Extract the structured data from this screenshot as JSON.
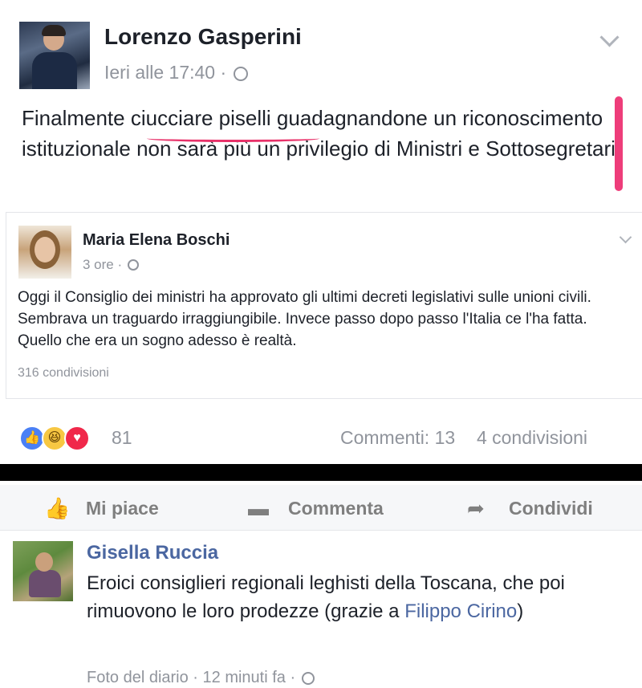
{
  "post": {
    "author": "Lorenzo Gasperini",
    "time": "Ieri alle 17:40 ·",
    "text": "Finalmente ciucciare piselli guadagnandone un riconoscimento istituzionale non sarà più un privilegio di Ministri e Sottosegretari."
  },
  "shared": {
    "author": "Maria Elena Boschi",
    "time": "3 ore ·",
    "text": "Oggi il Consiglio dei ministri ha approvato gli ultimi decreti legislativi sulle unioni civili. Sembrava un traguardo irraggiungibile. Invece passo dopo passo l'Italia ce l'ha fatta. Quello che era un sogno adesso è realtà.",
    "shares": "316 condivisioni"
  },
  "engagement": {
    "reaction_count": "81",
    "comments": "Commenti: 13",
    "shares": "4 condivisioni"
  },
  "actions": {
    "like": "Mi piace",
    "comment": "Commenta",
    "share": "Condividi"
  },
  "comment": {
    "author": "Gisella Ruccia",
    "text_before": "Eroici consiglieri regionali leghisti della Toscana, che poi rimuovono le loro prodezze (grazie a ",
    "link": "Filippo Cirino",
    "text_after": ")",
    "meta": "Foto del diario · 12 minuti fa ·"
  },
  "icons": {
    "like": "like-icon",
    "haha": "haha-icon",
    "love": "love-icon",
    "globe": "globe-icon",
    "chevron": "chevron-down-icon",
    "comment": "comment-icon",
    "share": "share-icon"
  },
  "colors": {
    "link": "#4b67a1",
    "meta": "#90949c",
    "highlight": "#ee3d7a"
  }
}
